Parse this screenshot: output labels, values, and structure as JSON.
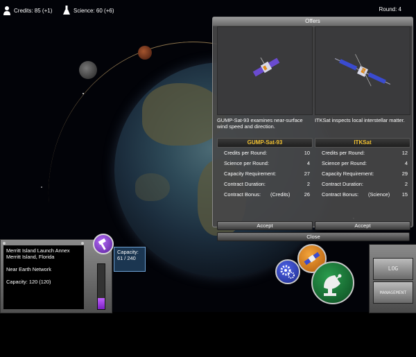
{
  "hud": {
    "credits": "Credits: 85 (+1)",
    "science": "Science: 60 (+6)",
    "round": "Round: 4"
  },
  "offers": {
    "title": "Offers",
    "stat_labels": {
      "credits": "Credits per Round:",
      "science": "Science per Round:",
      "capacity": "Capacity Requirement:",
      "duration": "Contract Duration:",
      "bonus": "Contract Bonus:"
    },
    "left": {
      "name": "GUMP-Sat-93",
      "description": "GUMP-Sat-93 examines near-surface wind speed and direction.",
      "credits": "10",
      "science": "4",
      "capacity": "27",
      "duration": "2",
      "bonus_type": "(Credits)",
      "bonus": "26",
      "accept_label": "Accept"
    },
    "right": {
      "name": "ITKSat",
      "description": "ITKSat inspects local interstellar matter.",
      "credits": "12",
      "science": "4",
      "capacity": "29",
      "duration": "2",
      "bonus_type": "(Science)",
      "bonus": "15",
      "accept_label": "Accept"
    },
    "close_label": "Close"
  },
  "location": {
    "line1": "Merritt Island Launch Annex",
    "line2": "Merritt Island, Florida",
    "network": "Near Earth Network",
    "capacity": "Capacity: 120 (120)"
  },
  "capacity_box": {
    "label": "Capacity:",
    "value": "61 / 240"
  },
  "capacity_fraction": 0.254,
  "side_buttons": {
    "log": "LOG",
    "management": "MANAGEMENT"
  },
  "icons": {
    "credits": "person-icon",
    "science": "flask-icon",
    "build": "hammer-icon",
    "settings": "gears-icon",
    "satellite": "satellite-icon",
    "dish": "satellite-dish-icon"
  },
  "colors": {
    "accent_gold": "#f0c030",
    "purple": "#9b4be0",
    "green": "#1f7a3a",
    "orange": "#e08a1a",
    "blue": "#2a3fb0"
  }
}
